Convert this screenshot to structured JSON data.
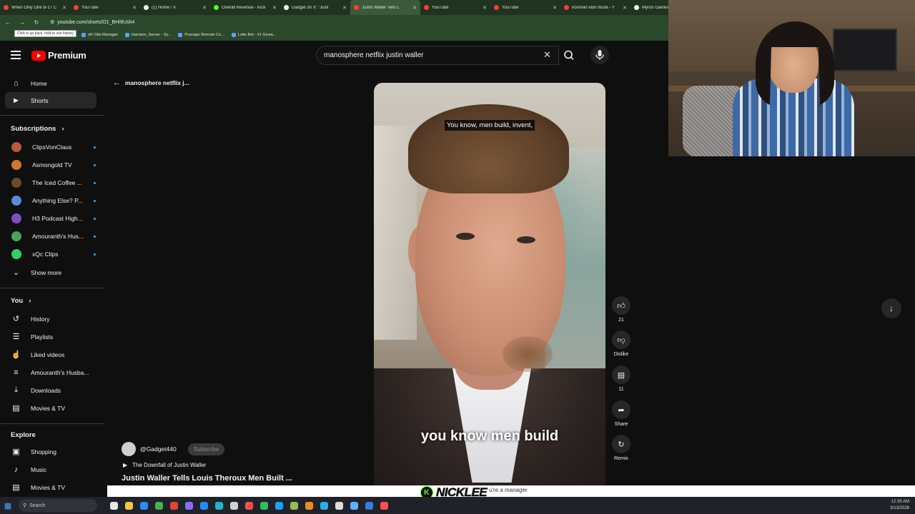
{
  "browser": {
    "tabs": [
      {
        "title": "When Only One B-17 C",
        "color": "#ff3b3b"
      },
      {
        "title": "YouTube",
        "color": "#ff3b3b"
      },
      {
        "title": "(1) Home / X",
        "color": "#ffffff"
      },
      {
        "title": "Overall Revenue - Kick",
        "color": "#53fc18"
      },
      {
        "title": "Gadget on X: \"Justi",
        "color": "#ffffff"
      },
      {
        "title": "Justin Waller Tells L",
        "color": "#ff3b3b"
      },
      {
        "title": "YouTube",
        "color": "#ff3b3b"
      },
      {
        "title": "YouTube",
        "color": "#ff3b3b"
      },
      {
        "title": "ironman elon musk - Y",
        "color": "#ff3b3b"
      },
      {
        "title": "Myron Gaines",
        "color": "#ffffff"
      }
    ],
    "url": "youtube.com/shorts/O1_BH/8Ush4",
    "back_tooltip": "Click to go back, hold to see history",
    "bookmarks": [
      "nFi Site Manager",
      "Harrison_Server - Sy...",
      "Poynaps Remote Co...",
      "Lotto Bot - #1 Givea..."
    ]
  },
  "header": {
    "logo_text": "Premium",
    "search_value": "manosphere netflix justin waller"
  },
  "sidebar": {
    "main": [
      {
        "label": "Home",
        "icon": "home-icon"
      },
      {
        "label": "Shorts",
        "icon": "shorts-icon"
      }
    ],
    "subscriptions_title": "Subscriptions",
    "subscriptions": [
      {
        "label": "ClipsVonClaus",
        "color": "#b85a3a"
      },
      {
        "label": "Asmongold TV",
        "color": "#d0772c"
      },
      {
        "label": "The Iced Coffee ...",
        "color": "#6b4b2c"
      },
      {
        "label": "Anything Else? P...",
        "color": "#5a8ad8"
      },
      {
        "label": "H3 Podcast High...",
        "color": "#7b4fc0"
      },
      {
        "label": "Amouranth's Hus...",
        "color": "#4aa35a"
      },
      {
        "label": "xQc Clips",
        "color": "#2fd06a"
      }
    ],
    "show_more": "Show more",
    "you_title": "You",
    "you_items": [
      {
        "label": "History",
        "icon": "history-icon"
      },
      {
        "label": "Playlists",
        "icon": "playlists-icon"
      },
      {
        "label": "Liked videos",
        "icon": "liked-icon"
      },
      {
        "label": "Amouranth's Husba...",
        "icon": "playlist-icon"
      },
      {
        "label": "Downloads",
        "icon": "download-icon"
      },
      {
        "label": "Movies & TV",
        "icon": "movies-icon"
      }
    ],
    "explore_title": "Explore",
    "explore_items": [
      {
        "label": "Shopping",
        "icon": "shopping-icon"
      },
      {
        "label": "Music",
        "icon": "music-icon"
      },
      {
        "label": "Movies & TV",
        "icon": "movies-icon"
      }
    ]
  },
  "shorts": {
    "query_label": "manosphere netflix j...",
    "caption_top": "You know, men build, invent,",
    "caption_big": "you know men build",
    "likes": "21",
    "dislike_label": "Dislike",
    "comments": "11",
    "share_label": "Share",
    "remix_label": "Remix",
    "channel": "@Gadget440",
    "subscribe_label": "Subscribe",
    "playlist_label": "The Downfall of Justin Waller",
    "title": "Justin Waller Tells Louis Theroux Men Built ..."
  },
  "overlay": {
    "streamer": "NICKLEE",
    "ticker_text": "u're a manager"
  },
  "taskbar": {
    "search_placeholder": "Search",
    "time": "12:35 AM",
    "date": "3/13/2026"
  }
}
